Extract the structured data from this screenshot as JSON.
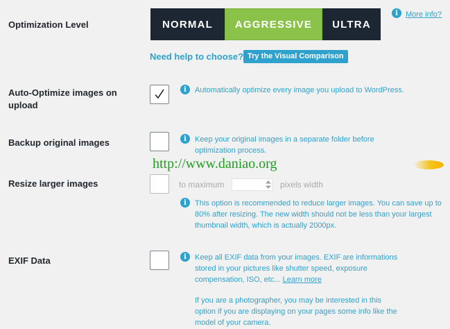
{
  "optimization": {
    "label": "Optimization Level",
    "options": [
      "NORMAL",
      "AGGRESSIVE",
      "ULTRA"
    ],
    "selected": "AGGRESSIVE",
    "more_info": "More info?",
    "help_text": "Need help to choose?",
    "visual_button": "Try the Visual Comparison"
  },
  "auto_optimize": {
    "label_line1": "Auto-Optimize images on",
    "label_line2": "upload",
    "checked": true,
    "info": "Automatically optimize every image you upload to WordPress."
  },
  "backup": {
    "label": "Backup original images",
    "checked": false,
    "info_line1": "Keep your original images in a separate folder before",
    "info_line2": "optimization process."
  },
  "watermark": "http://www.daniao.org",
  "resize": {
    "label": "Resize larger images",
    "checked": false,
    "prefix": "to maximum",
    "suffix": "pixels width",
    "info_line1": "This option is recommended to reduce larger images. You can save up to",
    "info_line2": "80% after resizing. The new width should not be less than your largest",
    "info_line3": "thumbnail width, which is actually 2000px."
  },
  "exif": {
    "label": "EXIF Data",
    "checked": false,
    "info_line1": "Keep all EXIF data from your images. EXIF are informations",
    "info_line2": "stored in your pictures like shutter speed, exposure",
    "info_line3": "compensation, ISO, etc...",
    "learn_more": "Learn more",
    "extra_line1": "If you are a photographer, you may be interested in this",
    "extra_line2": "option if you are displaying on your pages some info like the",
    "extra_line3": "model of your camera."
  },
  "colors": {
    "accent": "#2ea2cc",
    "selected_green": "#8bc34a",
    "dark": "#1d2733",
    "background": "#f1f1f1"
  }
}
